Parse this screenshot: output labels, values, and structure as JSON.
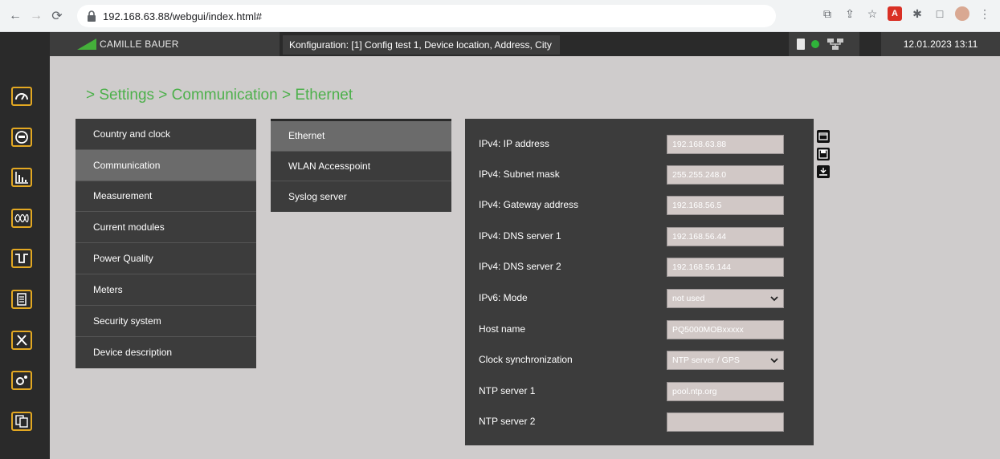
{
  "browser": {
    "url": "192.168.63.88/webgui/index.html#"
  },
  "header": {
    "brand": "CAMILLE BAUER",
    "config": "Konfiguration: [1] Config test 1, Device location, Address, City",
    "datetime": "12.01.2023  13:11",
    "status_color": "#2fb33a",
    "accent": "#44b03a"
  },
  "rail": {
    "icons": [
      "gauge-icon",
      "meter-icon",
      "bar-chart-icon",
      "waveform-icon",
      "pulse-icon",
      "list-icon",
      "tools-icon",
      "settings-gear-icon",
      "documents-icon"
    ],
    "color": "#e3a822"
  },
  "breadcrumb": "> Settings > Communication > Ethernet",
  "menu_primary": [
    {
      "label": "Country and clock",
      "active": false
    },
    {
      "label": "Communication",
      "active": true
    },
    {
      "label": "Measurement",
      "active": false
    },
    {
      "label": "Current modules",
      "active": false
    },
    {
      "label": "Power Quality",
      "active": false
    },
    {
      "label": "Meters",
      "active": false
    },
    {
      "label": "Security system",
      "active": false
    },
    {
      "label": "Device description",
      "active": false
    }
  ],
  "menu_secondary": [
    {
      "label": "Ethernet",
      "active": true
    },
    {
      "label": "WLAN Accesspoint",
      "active": false
    },
    {
      "label": "Syslog server",
      "active": false
    }
  ],
  "form": {
    "rows": [
      {
        "label": "IPv4: IP address",
        "value": "192.168.63.88",
        "type": "text"
      },
      {
        "label": "IPv4: Subnet mask",
        "value": "255.255.248.0",
        "type": "text"
      },
      {
        "label": "IPv4: Gateway address",
        "value": "192.168.56.5",
        "type": "text"
      },
      {
        "label": "IPv4: DNS server 1",
        "value": "192.168.56.44",
        "type": "text"
      },
      {
        "label": "IPv4: DNS server 2",
        "value": "192.168.56.144",
        "type": "text"
      },
      {
        "label": "IPv6: Mode",
        "value": "not used",
        "type": "select"
      },
      {
        "label": "Host name",
        "value": "PQ5000MOBxxxxx",
        "type": "text"
      },
      {
        "label": "Clock synchronization",
        "value": "NTP server / GPS",
        "type": "select"
      },
      {
        "label": "NTP server 1",
        "value": "pool.ntp.org",
        "type": "text"
      },
      {
        "label": "NTP server 2",
        "value": "",
        "type": "text"
      }
    ]
  },
  "side_icons": [
    "open-folder-icon",
    "save-icon",
    "download-icon"
  ]
}
